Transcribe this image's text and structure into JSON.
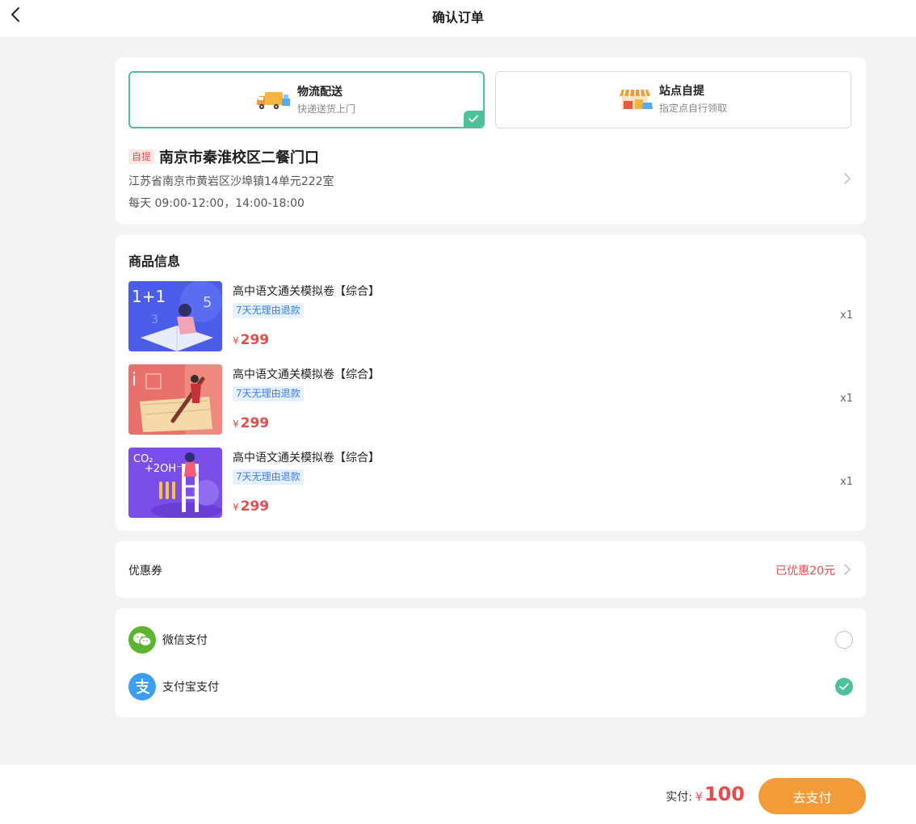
{
  "header": {
    "title": "确认订单",
    "back_icon": "chevron-left-icon"
  },
  "delivery": {
    "options": [
      {
        "name": "物流配送",
        "desc": "快递送货上门",
        "icon": "truck-icon",
        "selected": true
      },
      {
        "name": "站点自提",
        "desc": "指定点自行领取",
        "icon": "store-icon",
        "selected": false
      }
    ],
    "address": {
      "tag": "自提",
      "name": "南京市秦淮校区二餐门口",
      "detail": "江苏省南京市黄岩区沙埠镇14单元222室",
      "hours": "每天 09:00-12:00，14:00-18:00"
    }
  },
  "goods": {
    "title": "商品信息",
    "items": [
      {
        "name": "高中语文通关模拟卷【综合】",
        "badge": "7天无理由退款",
        "currency": "¥",
        "price": "299",
        "qty": "x1"
      },
      {
        "name": "高中语文通关模拟卷【综合】",
        "badge": "7天无理由退款",
        "currency": "¥",
        "price": "299",
        "qty": "x1"
      },
      {
        "name": "高中语文通关模拟卷【综合】",
        "badge": "7天无理由退款",
        "currency": "¥",
        "price": "299",
        "qty": "x1"
      }
    ]
  },
  "coupon": {
    "label": "优惠券",
    "value": "已优惠20元"
  },
  "payment": {
    "methods": [
      {
        "label": "微信支付",
        "icon": "wechat-pay-icon",
        "color": "#5cb531",
        "selected": false
      },
      {
        "label": "支付宝支付",
        "icon": "alipay-icon",
        "color": "#3c9ef0",
        "selected": true
      }
    ]
  },
  "footer": {
    "pay_label": "实付:",
    "currency": "¥",
    "amount": "100",
    "button": "去支付"
  },
  "colors": {
    "accent_green": "#4dc19a",
    "price_red": "#e84b4b",
    "button_orange": "#f29c39"
  }
}
